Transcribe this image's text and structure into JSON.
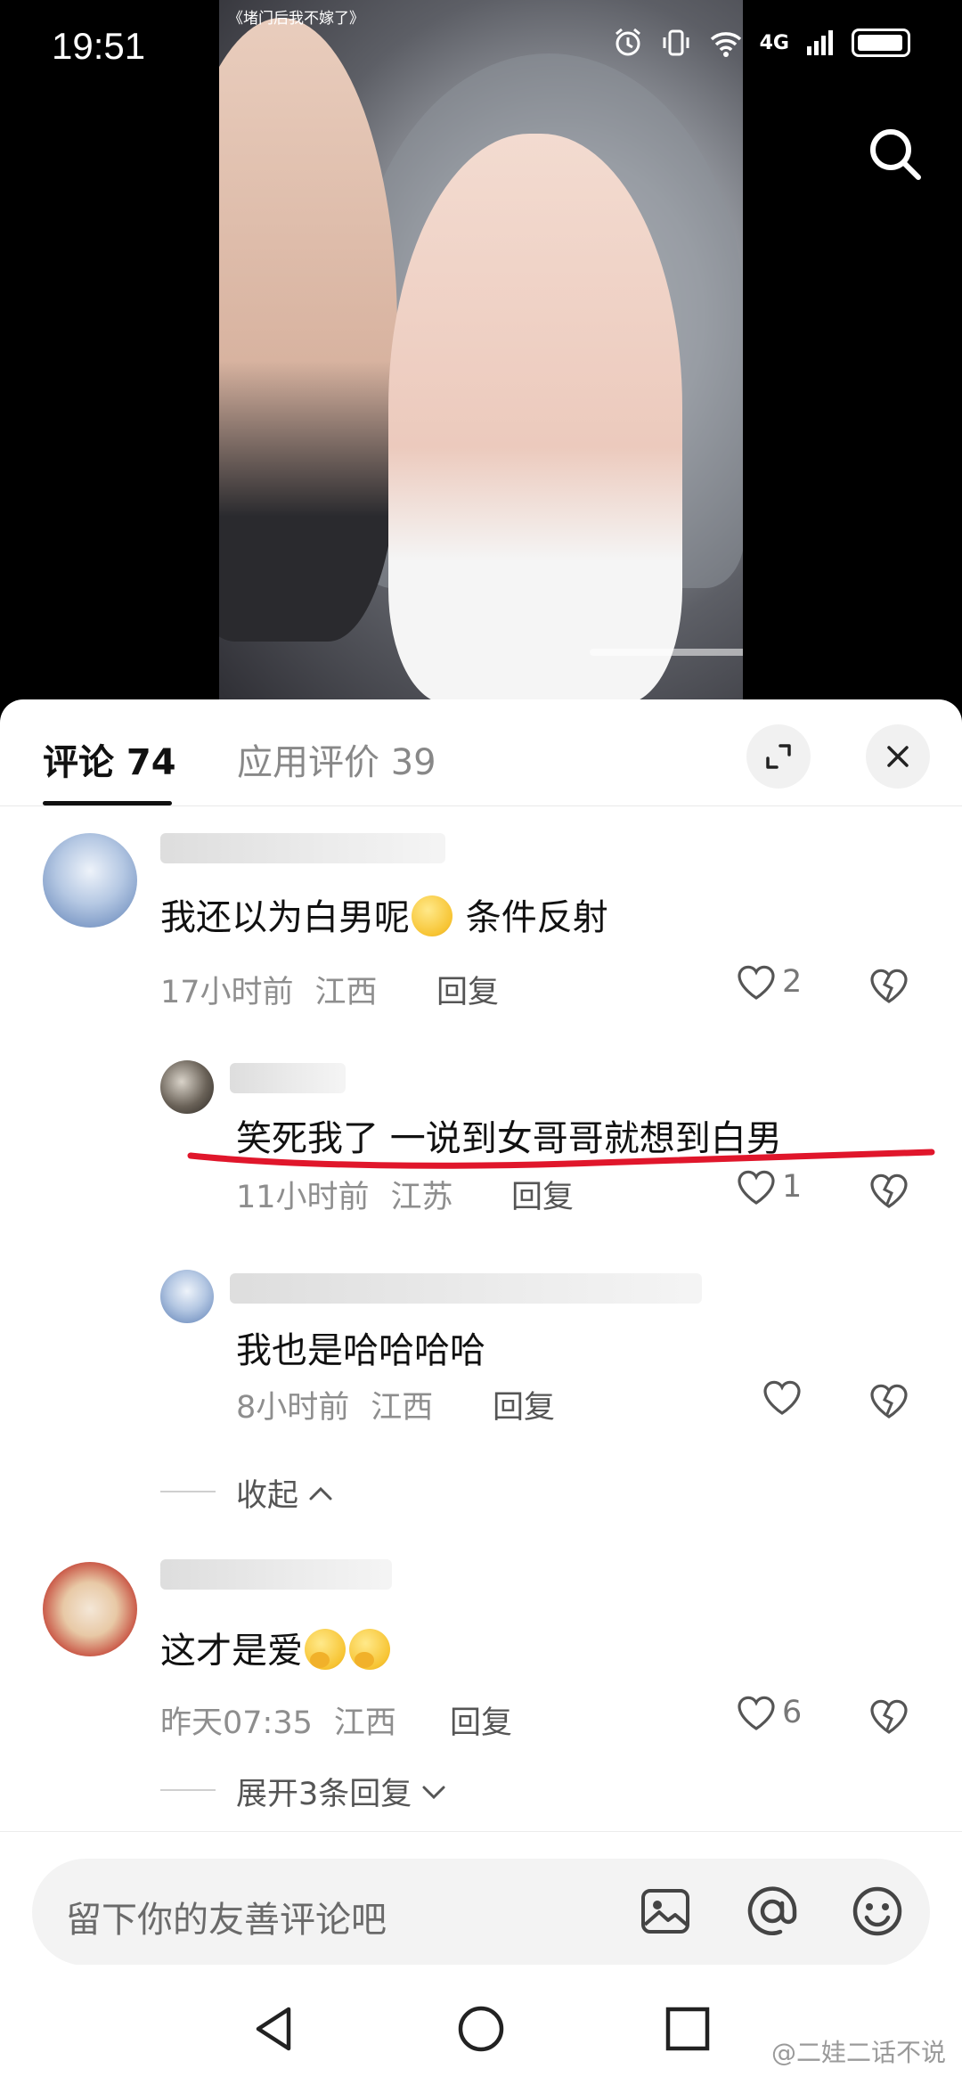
{
  "status_bar": {
    "time": "19:51",
    "network": "4G"
  },
  "video": {
    "title_overlay": "《堵门后我不嫁了》"
  },
  "sheet": {
    "tabs": [
      {
        "label": "评论 74"
      },
      {
        "label": "应用评价 39"
      }
    ],
    "comments": [
      {
        "text": "我还以为白男呢",
        "text_suffix": "条件反射",
        "time": "17小时前",
        "location": "江西",
        "reply_label": "回复",
        "likes": "2",
        "replies": [
          {
            "text": "笑死我了 一说到女哥哥就想到白男",
            "time": "11小时前",
            "location": "江苏",
            "reply_label": "回复",
            "likes": "1"
          },
          {
            "text": "我也是哈哈哈哈",
            "time": "8小时前",
            "location": "江西",
            "reply_label": "回复",
            "likes": ""
          }
        ],
        "fold_label": "收起"
      },
      {
        "text": "这才是爱",
        "time": "昨天07:35",
        "location": "江西",
        "reply_label": "回复",
        "likes": "6",
        "expand_label": "展开3条回复"
      }
    ]
  },
  "input": {
    "placeholder": "留下你的友善评论吧"
  },
  "watermark": "@二娃二话不说",
  "colors": {
    "highlight_underline": "#e0162b",
    "sheet_bg": "#ffffff"
  }
}
